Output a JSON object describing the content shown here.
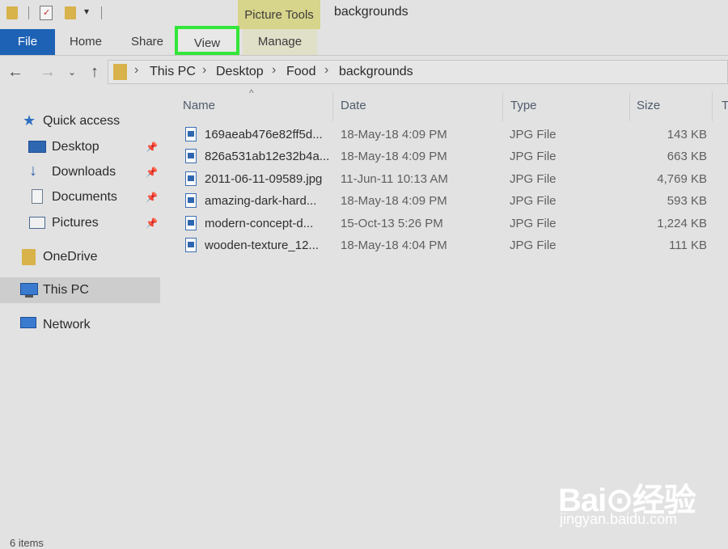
{
  "titlebar": {
    "context_tab": "Picture Tools",
    "window_title": "backgrounds"
  },
  "ribbon": {
    "tabs": [
      {
        "label": "File"
      },
      {
        "label": "Home"
      },
      {
        "label": "Share"
      },
      {
        "label": "View"
      },
      {
        "label": "Manage"
      }
    ],
    "highlight_color": "#33e63a",
    "file_tab_color": "#1e62b5"
  },
  "address": {
    "crumbs": [
      "This PC",
      "Desktop",
      "Food",
      "backgrounds"
    ]
  },
  "nav_pane": {
    "items": [
      {
        "label": "Quick access",
        "icon": "star-icon"
      },
      {
        "label": "Desktop",
        "icon": "desktop-icon",
        "pinned": true
      },
      {
        "label": "Downloads",
        "icon": "download-arrow-icon",
        "pinned": true
      },
      {
        "label": "Documents",
        "icon": "document-icon",
        "pinned": true
      },
      {
        "label": "Pictures",
        "icon": "pictures-icon",
        "pinned": true
      },
      {
        "label": "OneDrive",
        "icon": "folder-icon"
      },
      {
        "label": "This PC",
        "icon": "computer-icon",
        "selected": true
      },
      {
        "label": "Network",
        "icon": "network-icon"
      }
    ]
  },
  "file_list": {
    "columns": [
      "Name",
      "Date",
      "Type",
      "Size",
      "T"
    ],
    "rows": [
      {
        "name": "169aeab476e82ff5d...",
        "date": "18-May-18 4:09 PM",
        "type": "JPG File",
        "size": "143 KB"
      },
      {
        "name": "826a531ab12e32b4a...",
        "date": "18-May-18 4:09 PM",
        "type": "JPG File",
        "size": "663 KB"
      },
      {
        "name": "2011-06-11-09589.jpg",
        "date": "11-Jun-11 10:13 AM",
        "type": "JPG File",
        "size": "4,769 KB"
      },
      {
        "name": "amazing-dark-hard...",
        "date": "18-May-18 4:09 PM",
        "type": "JPG File",
        "size": "593 KB"
      },
      {
        "name": "modern-concept-d...",
        "date": "15-Oct-13 5:26 PM",
        "type": "JPG File",
        "size": "1,224 KB"
      },
      {
        "name": "wooden-texture_12...",
        "date": "18-May-18 4:04 PM",
        "type": "JPG File",
        "size": "111 KB"
      }
    ]
  },
  "status_bar": {
    "text": "6 items"
  },
  "watermark": {
    "brand": "Bai⊙经验",
    "url": "jingyan.baidu.com"
  }
}
